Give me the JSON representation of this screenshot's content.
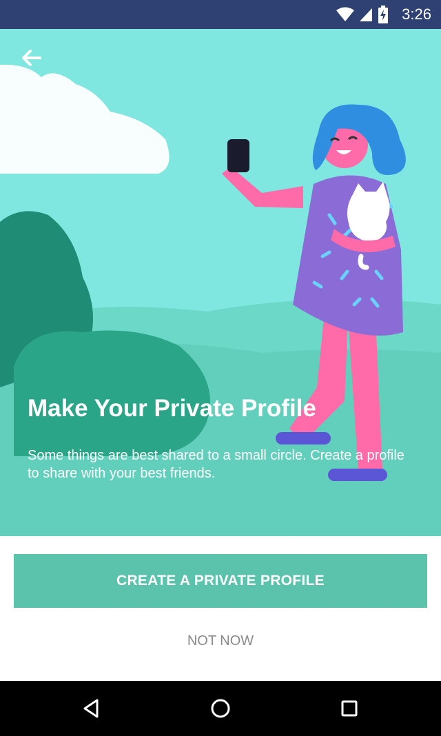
{
  "status_bar": {
    "time": "3:26",
    "icons": [
      "wifi-icon",
      "cell-signal-icon",
      "battery-charging-icon"
    ]
  },
  "hero": {
    "back_icon": "arrow-left-icon",
    "title": "Make Your Private Profile",
    "description": "Some things are best shared to a small circle. Create a profile to share with your best friends.",
    "colors": {
      "sky": "#7fe6e0",
      "ground": "#66d2c1",
      "bush": "#2aa587",
      "dress": "#8b6bd6",
      "skin": "#ff6aa8",
      "hair": "#2f8ee0"
    }
  },
  "actions": {
    "primary_label": "CREATE A PRIVATE PROFILE",
    "secondary_label": "NOT NOW",
    "primary_color": "#5bc3ab"
  },
  "nav_bar": {
    "icons": [
      "back-triangle-icon",
      "home-circle-icon",
      "recents-square-icon"
    ]
  }
}
